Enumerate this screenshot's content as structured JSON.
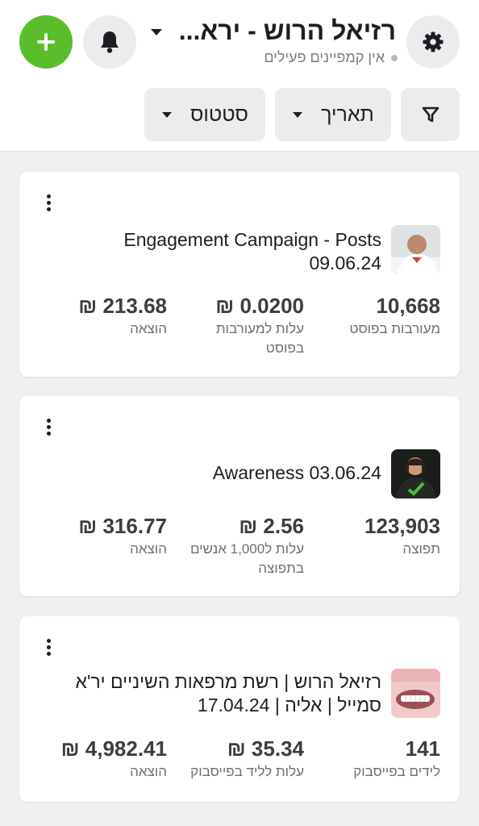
{
  "header": {
    "account_name": "רזיאל הרוש - ירא...",
    "account_status": "אין קמפיינים פעילים",
    "add_label": "+",
    "filters": {
      "date_label": "תאריך",
      "status_label": "סטטוס"
    }
  },
  "colors": {
    "add_button": "#5bbd2b",
    "button_bg": "#ececee",
    "page_bg": "#f0f0f2"
  },
  "icons": {
    "add": "plus-icon",
    "notifications": "bell-icon",
    "settings": "gear-icon",
    "filter": "funnel-icon",
    "dropdown": "caret-down-icon",
    "card_menu": "more-vertical-icon"
  },
  "campaigns": [
    {
      "title": "Engagement Campaign - Posts 09.06.24",
      "metrics": [
        {
          "value": "10,668",
          "label": "מעורבות בפוסט"
        },
        {
          "value": "0.0200 ₪",
          "label": "עלות למעורבות בפוסט"
        },
        {
          "value": "213.68 ₪",
          "label": "הוצאה"
        }
      ]
    },
    {
      "title": "Awareness 03.06.24",
      "metrics": [
        {
          "value": "123,903",
          "label": "תפוצה"
        },
        {
          "value": "2.56 ₪",
          "label": "עלות ל1,000 אנשים בתפוצה"
        },
        {
          "value": "316.77 ₪",
          "label": "הוצאה"
        }
      ]
    },
    {
      "title": "רזיאל הרוש | רשת מרפאות השיניים יר'א סמייל | אליה | 17.04.24",
      "metrics": [
        {
          "value": "141",
          "label": "לידים בפייסבוק"
        },
        {
          "value": "35.34 ₪",
          "label": "עלות לליד בפייסבוק"
        },
        {
          "value": "4,982.41 ₪",
          "label": "הוצאה"
        }
      ]
    }
  ]
}
